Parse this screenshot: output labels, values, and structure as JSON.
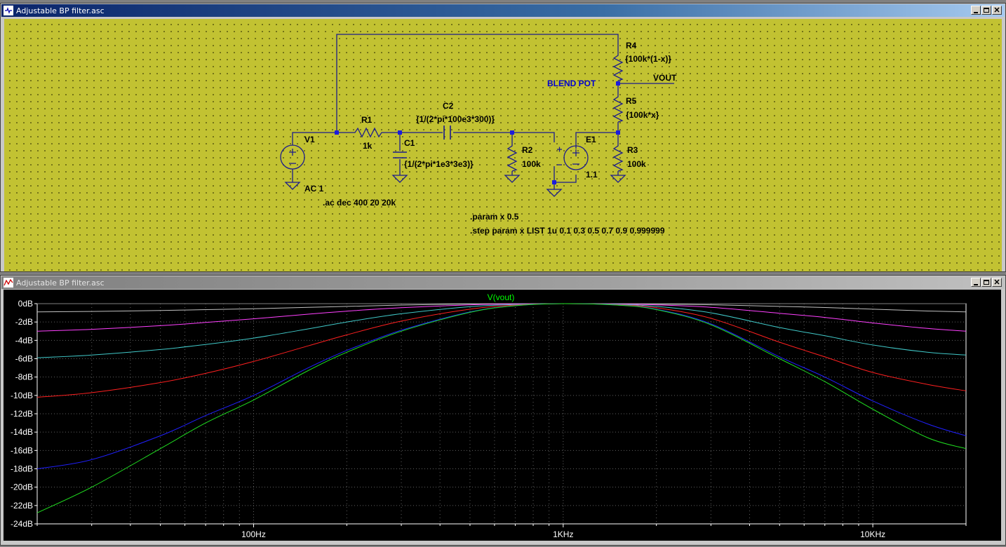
{
  "schematic": {
    "window_title": "Adjustable BP filter.asc",
    "background": "#c2c232",
    "wire_color": "#1c1c8c",
    "text_color": "#000000",
    "label_color": "#0000cc",
    "components": {
      "v1": {
        "name": "V1",
        "value": "AC 1"
      },
      "r1": {
        "name": "R1",
        "value": "1k"
      },
      "c1": {
        "name": "C1",
        "value": "{1/(2*pi*1e3*3e3)}"
      },
      "c2": {
        "name": "C2",
        "value": "{1/(2*pi*100e3*300)}"
      },
      "r2": {
        "name": "R2",
        "value": "100k"
      },
      "e1": {
        "name": "E1",
        "value": "1.1"
      },
      "r3": {
        "name": "R3",
        "value": "100k"
      },
      "r4": {
        "name": "R4",
        "value": "{100k*(1-x)}"
      },
      "r5": {
        "name": "R5",
        "value": "{100k*x}"
      }
    },
    "labels": {
      "blend_pot": "BLEND POT",
      "vout": "VOUT"
    },
    "directives": {
      "ac": ".ac dec 400 20 20k",
      "param": ".param x 0.5",
      "step": ".step param x LIST 1u 0.1 0.3 0.5 0.7 0.9 0.999999"
    }
  },
  "waveform": {
    "window_title": "Adjustable BP filter.asc",
    "trace_label": "V(vout)",
    "trace_label_color": "#00ff00",
    "axis_color": "#ffffff",
    "grid_color": "#606060",
    "plot_background": "#000000"
  },
  "chart_data": {
    "type": "line",
    "title": "V(vout)",
    "x_scale": "log",
    "xlim": [
      20,
      20000
    ],
    "ylim": [
      -24,
      0
    ],
    "y_ticks": [
      "0dB",
      "-2dB",
      "-4dB",
      "-6dB",
      "-8dB",
      "-10dB",
      "-12dB",
      "-14dB",
      "-16dB",
      "-18dB",
      "-20dB",
      "-22dB",
      "-24dB"
    ],
    "y_tick_values": [
      0,
      -2,
      -4,
      -6,
      -8,
      -10,
      -12,
      -14,
      -16,
      -18,
      -20,
      -22,
      -24
    ],
    "x_ticks": [
      "100Hz",
      "1KHz",
      "10KHz"
    ],
    "x_tick_values": [
      100,
      1000,
      10000
    ],
    "grid": true,
    "x": [
      20,
      30,
      50,
      70,
      100,
      150,
      200,
      300,
      500,
      700,
      1000,
      1500,
      2000,
      3000,
      5000,
      7000,
      10000,
      15000,
      20000
    ],
    "series": [
      {
        "color": "#808080",
        "values": [
          0,
          0,
          0,
          0,
          0,
          0,
          0,
          0,
          0,
          0,
          0,
          0,
          0,
          0,
          0,
          0,
          0,
          0,
          0
        ]
      },
      {
        "color": "#c0c0c0",
        "values": [
          -0.9,
          -0.85,
          -0.75,
          -0.65,
          -0.55,
          -0.4,
          -0.3,
          -0.15,
          -0.04,
          -0.01,
          0,
          -0.01,
          -0.05,
          -0.12,
          -0.3,
          -0.42,
          -0.6,
          -0.8,
          -0.9
        ]
      },
      {
        "color": "#ff40ff",
        "values": [
          -3.0,
          -2.8,
          -2.4,
          -2.05,
          -1.65,
          -1.15,
          -0.82,
          -0.44,
          -0.13,
          -0.04,
          0,
          -0.04,
          -0.13,
          -0.4,
          -1.05,
          -1.5,
          -2.1,
          -2.7,
          -3.0
        ]
      },
      {
        "color": "#40c8c8",
        "values": [
          -5.9,
          -5.6,
          -5.0,
          -4.45,
          -3.75,
          -2.75,
          -2.0,
          -1.1,
          -0.33,
          -0.09,
          0,
          -0.08,
          -0.3,
          -1.0,
          -2.6,
          -3.5,
          -4.5,
          -5.3,
          -5.6
        ]
      },
      {
        "color": "#ff2020",
        "values": [
          -10.2,
          -9.7,
          -8.6,
          -7.6,
          -6.3,
          -4.6,
          -3.4,
          -1.9,
          -0.6,
          -0.16,
          0,
          -0.12,
          -0.45,
          -1.6,
          -4.2,
          -5.8,
          -7.5,
          -8.8,
          -9.5
        ]
      },
      {
        "color": "#2020ff",
        "values": [
          -18.0,
          -17.0,
          -14.4,
          -12.2,
          -10.0,
          -7.0,
          -5.1,
          -2.9,
          -0.9,
          -0.22,
          0,
          -0.15,
          -0.6,
          -2.2,
          -5.8,
          -8.0,
          -10.6,
          -13.1,
          -14.4
        ]
      },
      {
        "color": "#20e020",
        "values": [
          -22.8,
          -20.0,
          -15.8,
          -13.0,
          -10.5,
          -7.3,
          -5.3,
          -3.0,
          -0.95,
          -0.23,
          0,
          -0.16,
          -0.65,
          -2.3,
          -6.0,
          -8.5,
          -11.5,
          -14.6,
          -15.8
        ]
      }
    ]
  }
}
